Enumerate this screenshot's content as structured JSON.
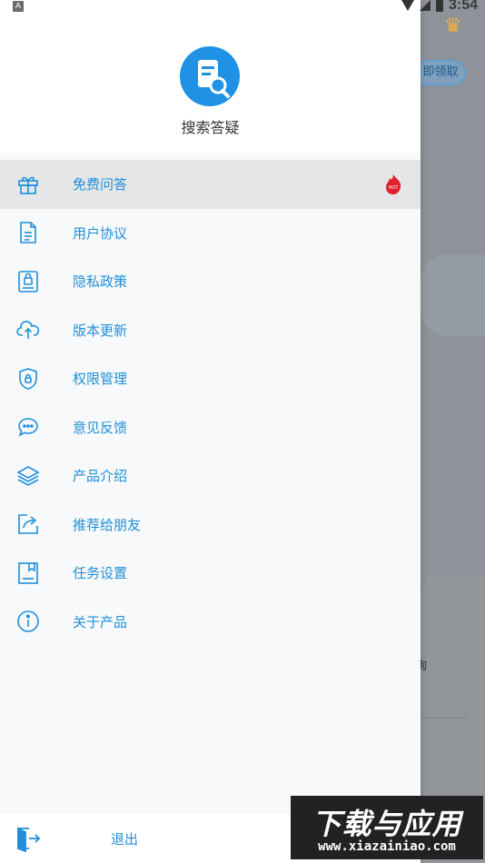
{
  "status_bar": {
    "left_indicator": "A",
    "time": "3:54"
  },
  "background_app": {
    "crown_icon": "crown-icon",
    "pill_label": "即领取",
    "card_text": "询"
  },
  "drawer": {
    "app_name": "搜索答疑",
    "accent_color": "#1f8fd9",
    "menu": [
      {
        "label": "免费问答",
        "icon": "gift-icon",
        "hot": true,
        "active": true
      },
      {
        "label": "用户协议",
        "icon": "document-icon"
      },
      {
        "label": "隐私政策",
        "icon": "privacy-lock-icon"
      },
      {
        "label": "版本更新",
        "icon": "cloud-upload-icon"
      },
      {
        "label": "权限管理",
        "icon": "shield-lock-icon"
      },
      {
        "label": "意见反馈",
        "icon": "chat-bubble-icon"
      },
      {
        "label": "产品介绍",
        "icon": "layers-icon"
      },
      {
        "label": "推荐给朋友",
        "icon": "share-icon"
      },
      {
        "label": "任务设置",
        "icon": "bookmark-doc-icon"
      },
      {
        "label": "关于产品",
        "icon": "info-icon"
      }
    ],
    "hot_badge": "HOT",
    "logout_label": "退出"
  },
  "watermark": {
    "title": "下载与应用",
    "url": "www.xiazainiao.com"
  }
}
